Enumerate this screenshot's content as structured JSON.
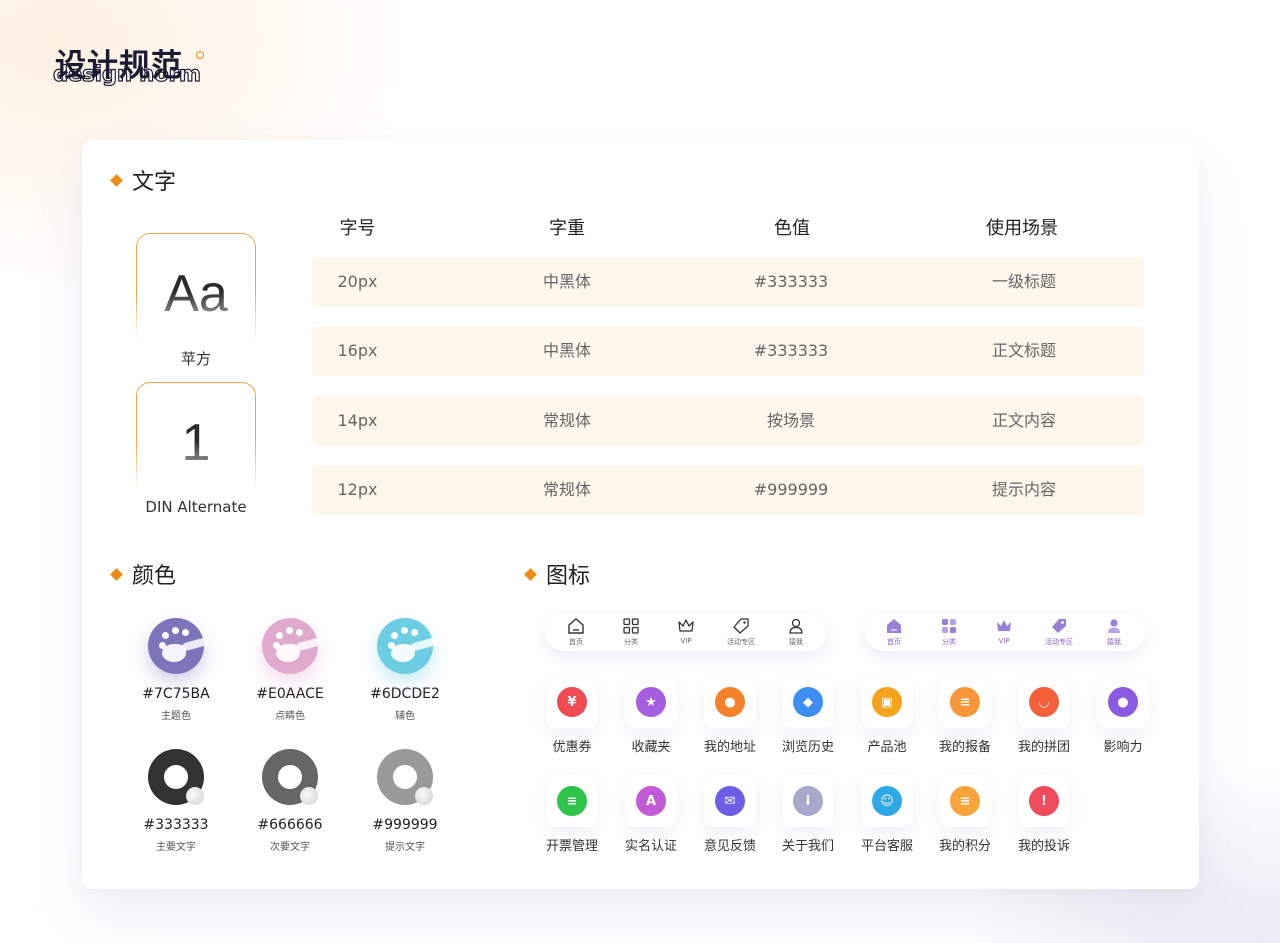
{
  "header": {
    "title": "设计规范",
    "subtitle": "design norm"
  },
  "sections": {
    "text": "文字",
    "color": "颜色",
    "icon": "图标"
  },
  "fonts": [
    {
      "sample": "Aa",
      "name": "苹方"
    },
    {
      "sample": "1",
      "name": "DIN Alternate"
    }
  ],
  "type_table": {
    "headers": [
      "字号",
      "字重",
      "色值",
      "使用场景"
    ],
    "rows": [
      [
        "20px",
        "中黑体",
        "#333333",
        "一级标题"
      ],
      [
        "16px",
        "中黑体",
        "#333333",
        "正文标题"
      ],
      [
        "14px",
        "常规体",
        "按场景",
        "正文内容"
      ],
      [
        "12px",
        "常规体",
        "#999999",
        "提示内容"
      ]
    ]
  },
  "colors": [
    {
      "hex": "#7C75BA",
      "desc": "主题色",
      "color": "#7C75BA"
    },
    {
      "hex": "#E0AACE",
      "desc": "点睛色",
      "color": "#E0AACE"
    },
    {
      "hex": "#6DCDE2",
      "desc": "辅色",
      "color": "#6DCDE2"
    },
    {
      "hex": "#333333",
      "desc": "主要文字",
      "color": "#333333"
    },
    {
      "hex": "#666666",
      "desc": "次要文字",
      "color": "#666666"
    },
    {
      "hex": "#999999",
      "desc": "提示文字",
      "color": "#999999"
    }
  ],
  "tabbar_outline": [
    {
      "label": "首页",
      "icon": "home-icon"
    },
    {
      "label": "分类",
      "icon": "grid-icon"
    },
    {
      "label": "VIP",
      "icon": "crown-icon"
    },
    {
      "label": "活动专区",
      "icon": "tag-icon"
    },
    {
      "label": "猿我",
      "icon": "user-icon"
    }
  ],
  "tabbar_filled": [
    {
      "label": "首页",
      "icon": "home-icon"
    },
    {
      "label": "分类",
      "icon": "grid-icon"
    },
    {
      "label": "VIP",
      "icon": "crown-icon"
    },
    {
      "label": "活动专区",
      "icon": "tag-icon"
    },
    {
      "label": "猿我",
      "icon": "user-icon"
    }
  ],
  "apps": [
    {
      "label": "优惠券",
      "icon": "coupon-icon",
      "color": "#f04b52",
      "glyph": "¥"
    },
    {
      "label": "收藏夹",
      "icon": "star-icon",
      "color": "#a45ee0",
      "glyph": "★"
    },
    {
      "label": "我的地址",
      "icon": "location-icon",
      "color": "#f5812a",
      "glyph": "●"
    },
    {
      "label": "浏览历史",
      "icon": "footprint-icon",
      "color": "#3d8ef0",
      "glyph": "◆"
    },
    {
      "label": "产品池",
      "icon": "bag-icon",
      "color": "#f7a21b",
      "glyph": "▣"
    },
    {
      "label": "我的报备",
      "icon": "clipboard-icon",
      "color": "#f7953a",
      "glyph": "≡"
    },
    {
      "label": "我的拼团",
      "icon": "cart-icon",
      "color": "#f4603a",
      "glyph": "◡"
    },
    {
      "label": "影响力",
      "icon": "people-icon",
      "color": "#8a5be0",
      "glyph": "●"
    },
    {
      "label": "开票管理",
      "icon": "invoice-icon",
      "color": "#2ec44a",
      "glyph": "≡"
    },
    {
      "label": "实名认证",
      "icon": "id-card-icon",
      "color": "#c25ad8",
      "glyph": "A"
    },
    {
      "label": "意见反馈",
      "icon": "mail-icon",
      "color": "#6d5ee8",
      "glyph": "✉"
    },
    {
      "label": "关于我们",
      "icon": "info-icon",
      "color": "#a8a8c8",
      "glyph": "i"
    },
    {
      "label": "平台客服",
      "icon": "headset-icon",
      "color": "#2fa8e8",
      "glyph": "☺"
    },
    {
      "label": "我的积分",
      "icon": "coins-icon",
      "color": "#f7a43a",
      "glyph": "≡"
    },
    {
      "label": "我的投诉",
      "icon": "warning-icon",
      "color": "#f04b5a",
      "glyph": "!"
    }
  ]
}
